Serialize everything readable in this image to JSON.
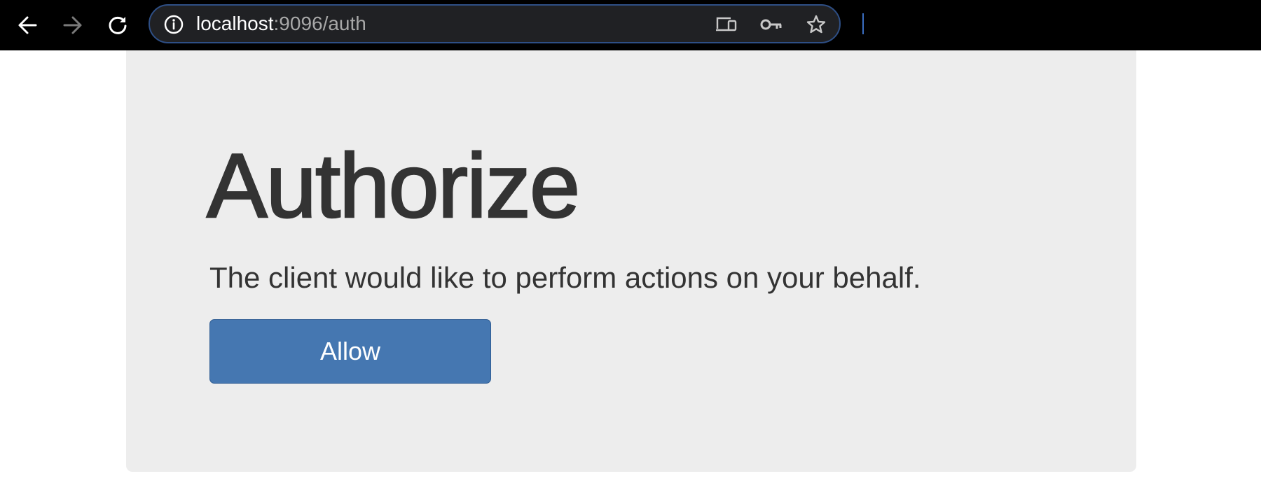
{
  "browser": {
    "url_host": "localhost",
    "url_rest": ":9096/auth"
  },
  "icons": {
    "back": "arrow-left",
    "forward": "arrow-right",
    "reload": "reload",
    "site_info": "info-circle",
    "cast": "devices",
    "password": "key",
    "bookmark": "star"
  },
  "page": {
    "title": "Authorize",
    "description": "The client would like to perform actions on your behalf.",
    "allow_label": "Allow"
  },
  "colors": {
    "toolbar": "#000000",
    "omnibox_border": "#2e4f86",
    "panel": "#ededed",
    "button": "#4577b1",
    "text": "#333333"
  }
}
